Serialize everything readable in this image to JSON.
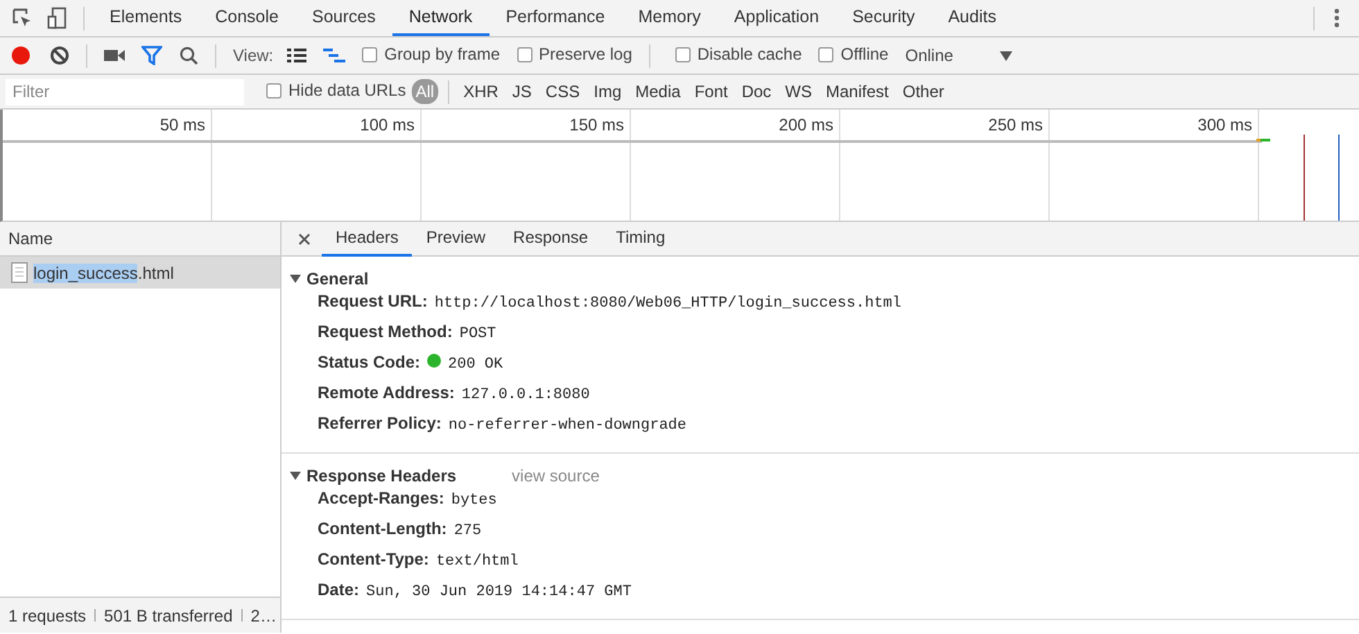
{
  "panel_tabs": [
    {
      "label": "Elements",
      "selected": false
    },
    {
      "label": "Console",
      "selected": false
    },
    {
      "label": "Sources",
      "selected": false
    },
    {
      "label": "Network",
      "selected": true
    },
    {
      "label": "Performance",
      "selected": false
    },
    {
      "label": "Memory",
      "selected": false
    },
    {
      "label": "Application",
      "selected": false
    },
    {
      "label": "Security",
      "selected": false
    },
    {
      "label": "Audits",
      "selected": false
    }
  ],
  "toolbar": {
    "recording": true,
    "filter_on": true,
    "view_label": "View:",
    "options": [
      {
        "label": "Group by frame",
        "checked": false
      },
      {
        "label": "Preserve log",
        "checked": false
      },
      {
        "label": "Disable cache",
        "checked": false
      },
      {
        "label": "Offline",
        "checked": false
      }
    ],
    "throttle": "Online"
  },
  "filter_bar": {
    "placeholder": "Filter",
    "hide_data_urls": {
      "label": "Hide data URLs",
      "checked": false
    },
    "types": [
      {
        "label": "All",
        "selected": true
      },
      {
        "label": "XHR",
        "selected": false
      },
      {
        "label": "JS",
        "selected": false
      },
      {
        "label": "CSS",
        "selected": false
      },
      {
        "label": "Img",
        "selected": false
      },
      {
        "label": "Media",
        "selected": false
      },
      {
        "label": "Font",
        "selected": false
      },
      {
        "label": "Doc",
        "selected": false
      },
      {
        "label": "WS",
        "selected": false
      },
      {
        "label": "Manifest",
        "selected": false
      },
      {
        "label": "Other",
        "selected": false
      }
    ]
  },
  "timeline": {
    "ticks": [
      "50 ms",
      "100 ms",
      "150 ms",
      "200 ms",
      "250 ms",
      "300 ms"
    ]
  },
  "requests": {
    "column": "Name",
    "rows": [
      {
        "highlighted": "login_success",
        "rest": ".html",
        "selected": true
      }
    ],
    "summary": [
      "1 requests",
      "501 B transferred",
      "2…"
    ]
  },
  "details": {
    "tabs": [
      {
        "label": "Headers",
        "selected": true
      },
      {
        "label": "Preview",
        "selected": false
      },
      {
        "label": "Response",
        "selected": false
      },
      {
        "label": "Timing",
        "selected": false
      }
    ],
    "sections": [
      {
        "title": "General",
        "expanded": true,
        "rows": [
          {
            "kind": "text",
            "key": "Request URL:",
            "value": "http://localhost:8080/Web06_HTTP/login_success.html"
          },
          {
            "kind": "text",
            "key": "Request Method:",
            "value": "POST"
          },
          {
            "kind": "status",
            "key": "Status Code:",
            "value": "200 OK"
          },
          {
            "kind": "text",
            "key": "Remote Address:",
            "value": "127.0.0.1:8080"
          },
          {
            "kind": "text",
            "key": "Referrer Policy:",
            "value": "no-referrer-when-downgrade"
          }
        ]
      },
      {
        "title": "Response Headers",
        "expanded": true,
        "link": "view source",
        "rows": [
          {
            "kind": "text",
            "key": "Accept-Ranges:",
            "value": "bytes"
          },
          {
            "kind": "text",
            "key": "Content-Length:",
            "value": "275"
          },
          {
            "kind": "text",
            "key": "Content-Type:",
            "value": "text/html"
          },
          {
            "kind": "text",
            "key": "Date:",
            "value": "Sun, 30 Jun 2019 14:14:47 GMT"
          }
        ]
      }
    ]
  }
}
